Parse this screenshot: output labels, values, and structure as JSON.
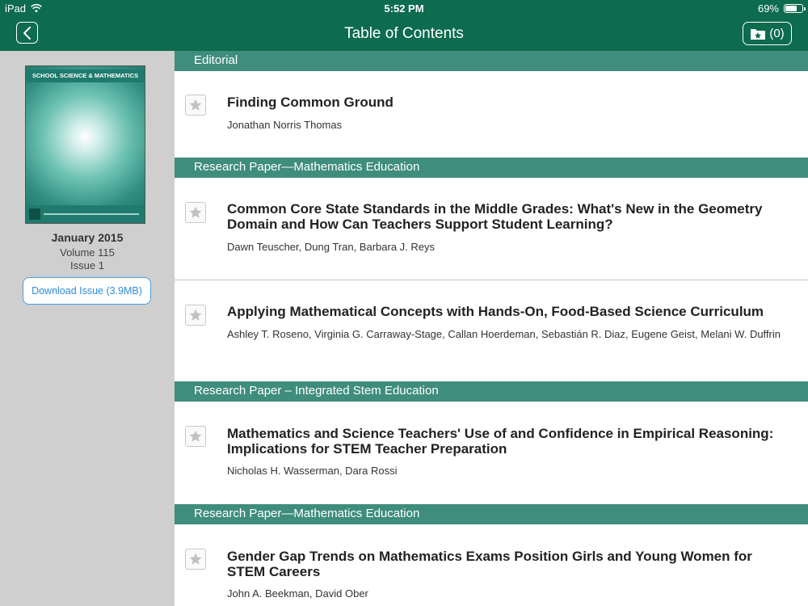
{
  "status_bar": {
    "device": "iPad",
    "time": "5:52 PM",
    "battery_text": "69%",
    "battery_level": 0.69
  },
  "nav": {
    "title": "Table of Contents",
    "saved_count": "(0)"
  },
  "sidebar": {
    "cover_title": "SCHOOL SCIENCE & MATHEMATICS",
    "issue_date": "January 2015",
    "volume": "Volume 115",
    "issue": "Issue 1",
    "download_label": "Download Issue (3.9MB)"
  },
  "sections": [
    {
      "label": "Editorial"
    },
    {
      "label": "Research Paper—Mathematics Education"
    },
    {
      "label": "Research Paper – Integrated Stem Education"
    },
    {
      "label": "Research Paper—Mathematics Education"
    }
  ],
  "articles": [
    {
      "title": "Finding Common Ground",
      "authors": "Jonathan Norris Thomas"
    },
    {
      "title": "Common Core State Standards in the Middle Grades: What's New in the Geometry Domain and How Can Teachers Support Student Learning?",
      "authors": "Dawn Teuscher, Dung Tran, Barbara J. Reys"
    },
    {
      "title": "Applying Mathematical Concepts with Hands-On, Food-Based Science Curriculum",
      "authors": "Ashley T. Roseno, Virginia G. Carraway-Stage, Callan Hoerdeman, Sebastián R. Diaz, Eugene Geist, Melani W. Duffrin"
    },
    {
      "title": "Mathematics and Science Teachers' Use of and Confidence in Empirical Reasoning: Implications for STEM Teacher Preparation",
      "authors": "Nicholas H. Wasserman, Dara Rossi"
    },
    {
      "title": "Gender Gap Trends on Mathematics Exams Position Girls and Young Women for STEM Careers",
      "authors": "John A. Beekman, David Ober"
    }
  ]
}
